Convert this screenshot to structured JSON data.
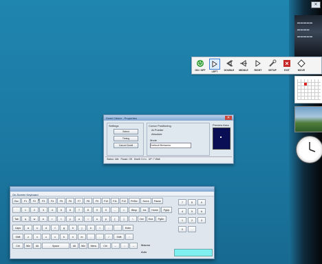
{
  "toolbar": {
    "buttons": [
      {
        "label": "ON / OFF",
        "icon": "power-icon"
      },
      {
        "label": "LEFT",
        "icon": "left-click-icon"
      },
      {
        "label": "DOUBLE",
        "icon": "double-click-icon"
      },
      {
        "label": "MIDDLE",
        "icon": "middle-click-icon"
      },
      {
        "label": "RIGHT",
        "icon": "right-click-icon"
      },
      {
        "label": "SETUP",
        "icon": "wrench-icon"
      },
      {
        "label": "EXIT",
        "icon": "exit-icon"
      },
      {
        "label": "MOVE",
        "icon": "move-icon"
      }
    ],
    "active_index": 1
  },
  "dialog": {
    "title": "Dwell Clicker - Properties",
    "left_group_title": "Settings",
    "buttons": [
      "Select",
      "Timing",
      "Cancel Dwell"
    ],
    "mid_group_title": "Cursor Positioning",
    "options": [
      "At Pointer",
      "Absolute"
    ],
    "mode_label": "Mode",
    "mode_value": "Default Behavior",
    "preview_title": "Preview Area",
    "status_fields": [
      "Status: Idle",
      "Pause: Off",
      "Dwell: 0.4 s",
      "UP: 7 Wait"
    ]
  },
  "keyboard": {
    "title": "On-Screen Keyboard",
    "menu": [
      "File",
      "Keyboard",
      "Settings",
      "Help"
    ],
    "rows": [
      [
        "Esc",
        "F1",
        "F2",
        "F3",
        "F4",
        "F5",
        "F6",
        "F7",
        "F8",
        "F9",
        "F10",
        "F11",
        "F12",
        "PrtScr",
        "ScrLk",
        "Pause"
      ],
      [
        "`",
        "1",
        "2",
        "3",
        "4",
        "5",
        "6",
        "7",
        "8",
        "9",
        "0",
        "-",
        "=",
        "Bksp",
        "Ins",
        "Home",
        "PgUp"
      ],
      [
        "Tab",
        "q",
        "w",
        "e",
        "r",
        "t",
        "y",
        "u",
        "i",
        "o",
        "p",
        "[",
        "]",
        "\\",
        "Del",
        "End",
        "PgDn"
      ],
      [
        "Caps",
        "a",
        "s",
        "d",
        "f",
        "g",
        "h",
        "j",
        "k",
        "l",
        ";",
        "'",
        "Enter"
      ],
      [
        "Shift",
        "z",
        "x",
        "c",
        "v",
        "b",
        "n",
        "m",
        ",",
        ".",
        "/",
        "Shift",
        "↑"
      ],
      [
        "Ctrl",
        "Win",
        "Alt",
        "Space",
        "Alt",
        "Win",
        "Menu",
        "Ctrl",
        "←",
        "↓",
        "→"
      ]
    ],
    "numpad": [
      "7",
      "8",
      "9",
      "4",
      "5",
      "6",
      "1",
      "2",
      "3",
      "0",
      "."
    ],
    "extra_labels": [
      "Macros",
      "Auto"
    ]
  },
  "colors": {
    "desktop": "#1e7fa8",
    "accent": "#3a7bd5",
    "keyboard_bar": "#7ff0f0"
  }
}
